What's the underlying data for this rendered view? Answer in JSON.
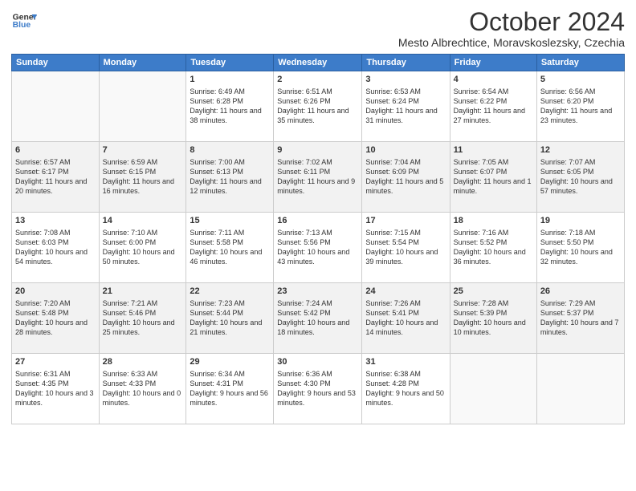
{
  "header": {
    "logo_line1": "General",
    "logo_line2": "Blue",
    "month": "October 2024",
    "location": "Mesto Albrechtice, Moravskoslezsky, Czechia"
  },
  "days_of_week": [
    "Sunday",
    "Monday",
    "Tuesday",
    "Wednesday",
    "Thursday",
    "Friday",
    "Saturday"
  ],
  "weeks": [
    [
      {
        "day": "",
        "info": ""
      },
      {
        "day": "",
        "info": ""
      },
      {
        "day": "1",
        "info": "Sunrise: 6:49 AM\nSunset: 6:28 PM\nDaylight: 11 hours and 38 minutes."
      },
      {
        "day": "2",
        "info": "Sunrise: 6:51 AM\nSunset: 6:26 PM\nDaylight: 11 hours and 35 minutes."
      },
      {
        "day": "3",
        "info": "Sunrise: 6:53 AM\nSunset: 6:24 PM\nDaylight: 11 hours and 31 minutes."
      },
      {
        "day": "4",
        "info": "Sunrise: 6:54 AM\nSunset: 6:22 PM\nDaylight: 11 hours and 27 minutes."
      },
      {
        "day": "5",
        "info": "Sunrise: 6:56 AM\nSunset: 6:20 PM\nDaylight: 11 hours and 23 minutes."
      }
    ],
    [
      {
        "day": "6",
        "info": "Sunrise: 6:57 AM\nSunset: 6:17 PM\nDaylight: 11 hours and 20 minutes."
      },
      {
        "day": "7",
        "info": "Sunrise: 6:59 AM\nSunset: 6:15 PM\nDaylight: 11 hours and 16 minutes."
      },
      {
        "day": "8",
        "info": "Sunrise: 7:00 AM\nSunset: 6:13 PM\nDaylight: 11 hours and 12 minutes."
      },
      {
        "day": "9",
        "info": "Sunrise: 7:02 AM\nSunset: 6:11 PM\nDaylight: 11 hours and 9 minutes."
      },
      {
        "day": "10",
        "info": "Sunrise: 7:04 AM\nSunset: 6:09 PM\nDaylight: 11 hours and 5 minutes."
      },
      {
        "day": "11",
        "info": "Sunrise: 7:05 AM\nSunset: 6:07 PM\nDaylight: 11 hours and 1 minute."
      },
      {
        "day": "12",
        "info": "Sunrise: 7:07 AM\nSunset: 6:05 PM\nDaylight: 10 hours and 57 minutes."
      }
    ],
    [
      {
        "day": "13",
        "info": "Sunrise: 7:08 AM\nSunset: 6:03 PM\nDaylight: 10 hours and 54 minutes."
      },
      {
        "day": "14",
        "info": "Sunrise: 7:10 AM\nSunset: 6:00 PM\nDaylight: 10 hours and 50 minutes."
      },
      {
        "day": "15",
        "info": "Sunrise: 7:11 AM\nSunset: 5:58 PM\nDaylight: 10 hours and 46 minutes."
      },
      {
        "day": "16",
        "info": "Sunrise: 7:13 AM\nSunset: 5:56 PM\nDaylight: 10 hours and 43 minutes."
      },
      {
        "day": "17",
        "info": "Sunrise: 7:15 AM\nSunset: 5:54 PM\nDaylight: 10 hours and 39 minutes."
      },
      {
        "day": "18",
        "info": "Sunrise: 7:16 AM\nSunset: 5:52 PM\nDaylight: 10 hours and 36 minutes."
      },
      {
        "day": "19",
        "info": "Sunrise: 7:18 AM\nSunset: 5:50 PM\nDaylight: 10 hours and 32 minutes."
      }
    ],
    [
      {
        "day": "20",
        "info": "Sunrise: 7:20 AM\nSunset: 5:48 PM\nDaylight: 10 hours and 28 minutes."
      },
      {
        "day": "21",
        "info": "Sunrise: 7:21 AM\nSunset: 5:46 PM\nDaylight: 10 hours and 25 minutes."
      },
      {
        "day": "22",
        "info": "Sunrise: 7:23 AM\nSunset: 5:44 PM\nDaylight: 10 hours and 21 minutes."
      },
      {
        "day": "23",
        "info": "Sunrise: 7:24 AM\nSunset: 5:42 PM\nDaylight: 10 hours and 18 minutes."
      },
      {
        "day": "24",
        "info": "Sunrise: 7:26 AM\nSunset: 5:41 PM\nDaylight: 10 hours and 14 minutes."
      },
      {
        "day": "25",
        "info": "Sunrise: 7:28 AM\nSunset: 5:39 PM\nDaylight: 10 hours and 10 minutes."
      },
      {
        "day": "26",
        "info": "Sunrise: 7:29 AM\nSunset: 5:37 PM\nDaylight: 10 hours and 7 minutes."
      }
    ],
    [
      {
        "day": "27",
        "info": "Sunrise: 6:31 AM\nSunset: 4:35 PM\nDaylight: 10 hours and 3 minutes."
      },
      {
        "day": "28",
        "info": "Sunrise: 6:33 AM\nSunset: 4:33 PM\nDaylight: 10 hours and 0 minutes."
      },
      {
        "day": "29",
        "info": "Sunrise: 6:34 AM\nSunset: 4:31 PM\nDaylight: 9 hours and 56 minutes."
      },
      {
        "day": "30",
        "info": "Sunrise: 6:36 AM\nSunset: 4:30 PM\nDaylight: 9 hours and 53 minutes."
      },
      {
        "day": "31",
        "info": "Sunrise: 6:38 AM\nSunset: 4:28 PM\nDaylight: 9 hours and 50 minutes."
      },
      {
        "day": "",
        "info": ""
      },
      {
        "day": "",
        "info": ""
      }
    ]
  ]
}
